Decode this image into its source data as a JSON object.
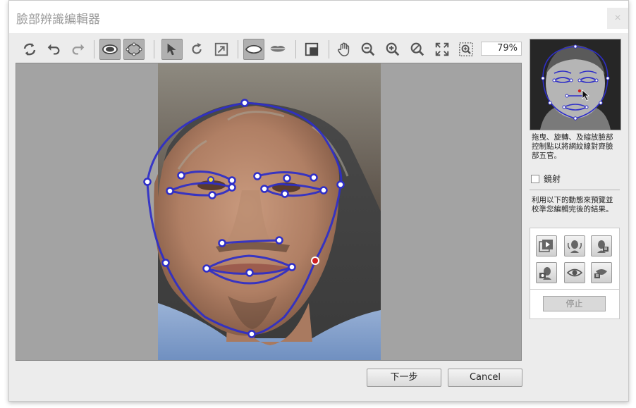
{
  "window": {
    "title": "臉部辨識編輯器",
    "close_symbol": "×"
  },
  "toolbar": {
    "zoom_value": "79%",
    "tools": [
      {
        "name": "rotate-reset-icon"
      },
      {
        "name": "undo-icon"
      },
      {
        "name": "redo-icon"
      },
      {
        "name": "eye-view-icon",
        "active": true
      },
      {
        "name": "control-points-icon",
        "active": true
      },
      {
        "name": "pointer-icon",
        "active": true
      },
      {
        "name": "rotate-icon"
      },
      {
        "name": "scale-icon"
      },
      {
        "name": "face-outline-icon",
        "active": true
      },
      {
        "name": "lips-icon"
      },
      {
        "name": "split-view-icon"
      },
      {
        "name": "hand-pan-icon"
      },
      {
        "name": "zoom-out-icon"
      },
      {
        "name": "zoom-in-icon"
      },
      {
        "name": "zoom-reset-icon"
      },
      {
        "name": "fit-screen-icon"
      },
      {
        "name": "zoom-area-icon"
      }
    ]
  },
  "right_panel": {
    "description": "拖曳、旋轉、及縮放臉部控制點以將網紋線對齊臉部五官。",
    "mirror_label": "鏡射",
    "mirror_checked": false,
    "animation_description": "利用以下的動態來預覽並校準您編輯完後的結果。",
    "animation_buttons": [
      {
        "name": "play-animation-icon"
      },
      {
        "name": "head-turn-icon"
      },
      {
        "name": "head-nod-icon"
      },
      {
        "name": "speak-icon"
      },
      {
        "name": "blink-icon"
      },
      {
        "name": "mouth-open-icon"
      }
    ],
    "stop_label": "停止"
  },
  "footer": {
    "next_label": "下一步",
    "cancel_label": "Cancel"
  },
  "colors": {
    "mesh_line": "#2e2ec8",
    "control_point_fill": "#ffffff",
    "selected_point": "#d02020",
    "canvas_background": "#a3a3a3"
  }
}
